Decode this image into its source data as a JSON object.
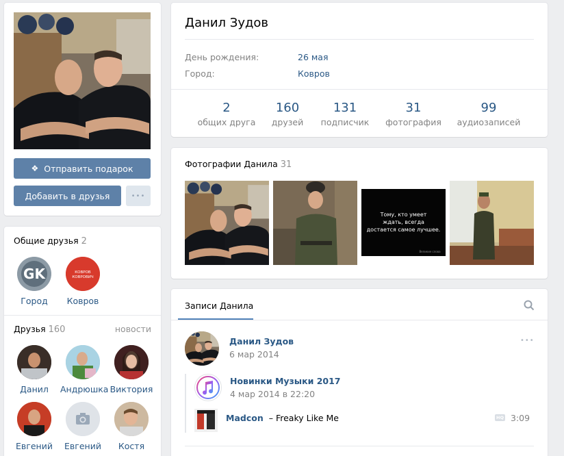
{
  "profile": {
    "name": "Данил Зудов",
    "buttons": {
      "gift": "Отправить подарок",
      "add_friend": "Добавить в друзья",
      "more": "•••"
    },
    "info": [
      {
        "label": "День рождения:",
        "value": "26 мая"
      },
      {
        "label": "Город:",
        "value": "Ковров"
      }
    ],
    "counters": [
      {
        "num": "2",
        "label": "общих друга"
      },
      {
        "num": "160",
        "label": "друзей"
      },
      {
        "num": "131",
        "label": "подписчик"
      },
      {
        "num": "31",
        "label": "фотография"
      },
      {
        "num": "99",
        "label": "аудиозаписей"
      }
    ]
  },
  "mutual": {
    "title": "Общие друзья",
    "count": "2",
    "items": [
      {
        "name": "Город",
        "logo": "GK"
      },
      {
        "name": "Ковров",
        "logo": "КОВРОВ КОВРОВИЧ"
      }
    ]
  },
  "friends": {
    "title": "Друзья",
    "count": "160",
    "link": "новости",
    "items": [
      {
        "name": "Данил"
      },
      {
        "name": "Андрюшка"
      },
      {
        "name": "Виктория"
      },
      {
        "name": "Евгений"
      },
      {
        "name": "Евгений"
      },
      {
        "name": "Костя"
      }
    ]
  },
  "photos": {
    "title": "Фотографии Данила",
    "count": "31",
    "quote": "Тому, кто умеет ждать, всегда достается самое лучшее.",
    "quote_sig": "Великие слова"
  },
  "wall": {
    "tab": "Записи Данила",
    "post": {
      "author": "Данил Зудов",
      "date": "6 мар 2014",
      "more": "•••",
      "repost": {
        "author": "Новинки Музыки 2017",
        "date": "4 мар 2014 в 22:20"
      },
      "audio": {
        "artist": "Madcon",
        "dash": "–",
        "title": "Freaky Like Me",
        "badge": "HQ",
        "duration": "3:09"
      }
    }
  },
  "colors": {
    "link": "#2a5885",
    "button": "#5e81a8",
    "background": "#edeef0",
    "muted": "#828282"
  }
}
